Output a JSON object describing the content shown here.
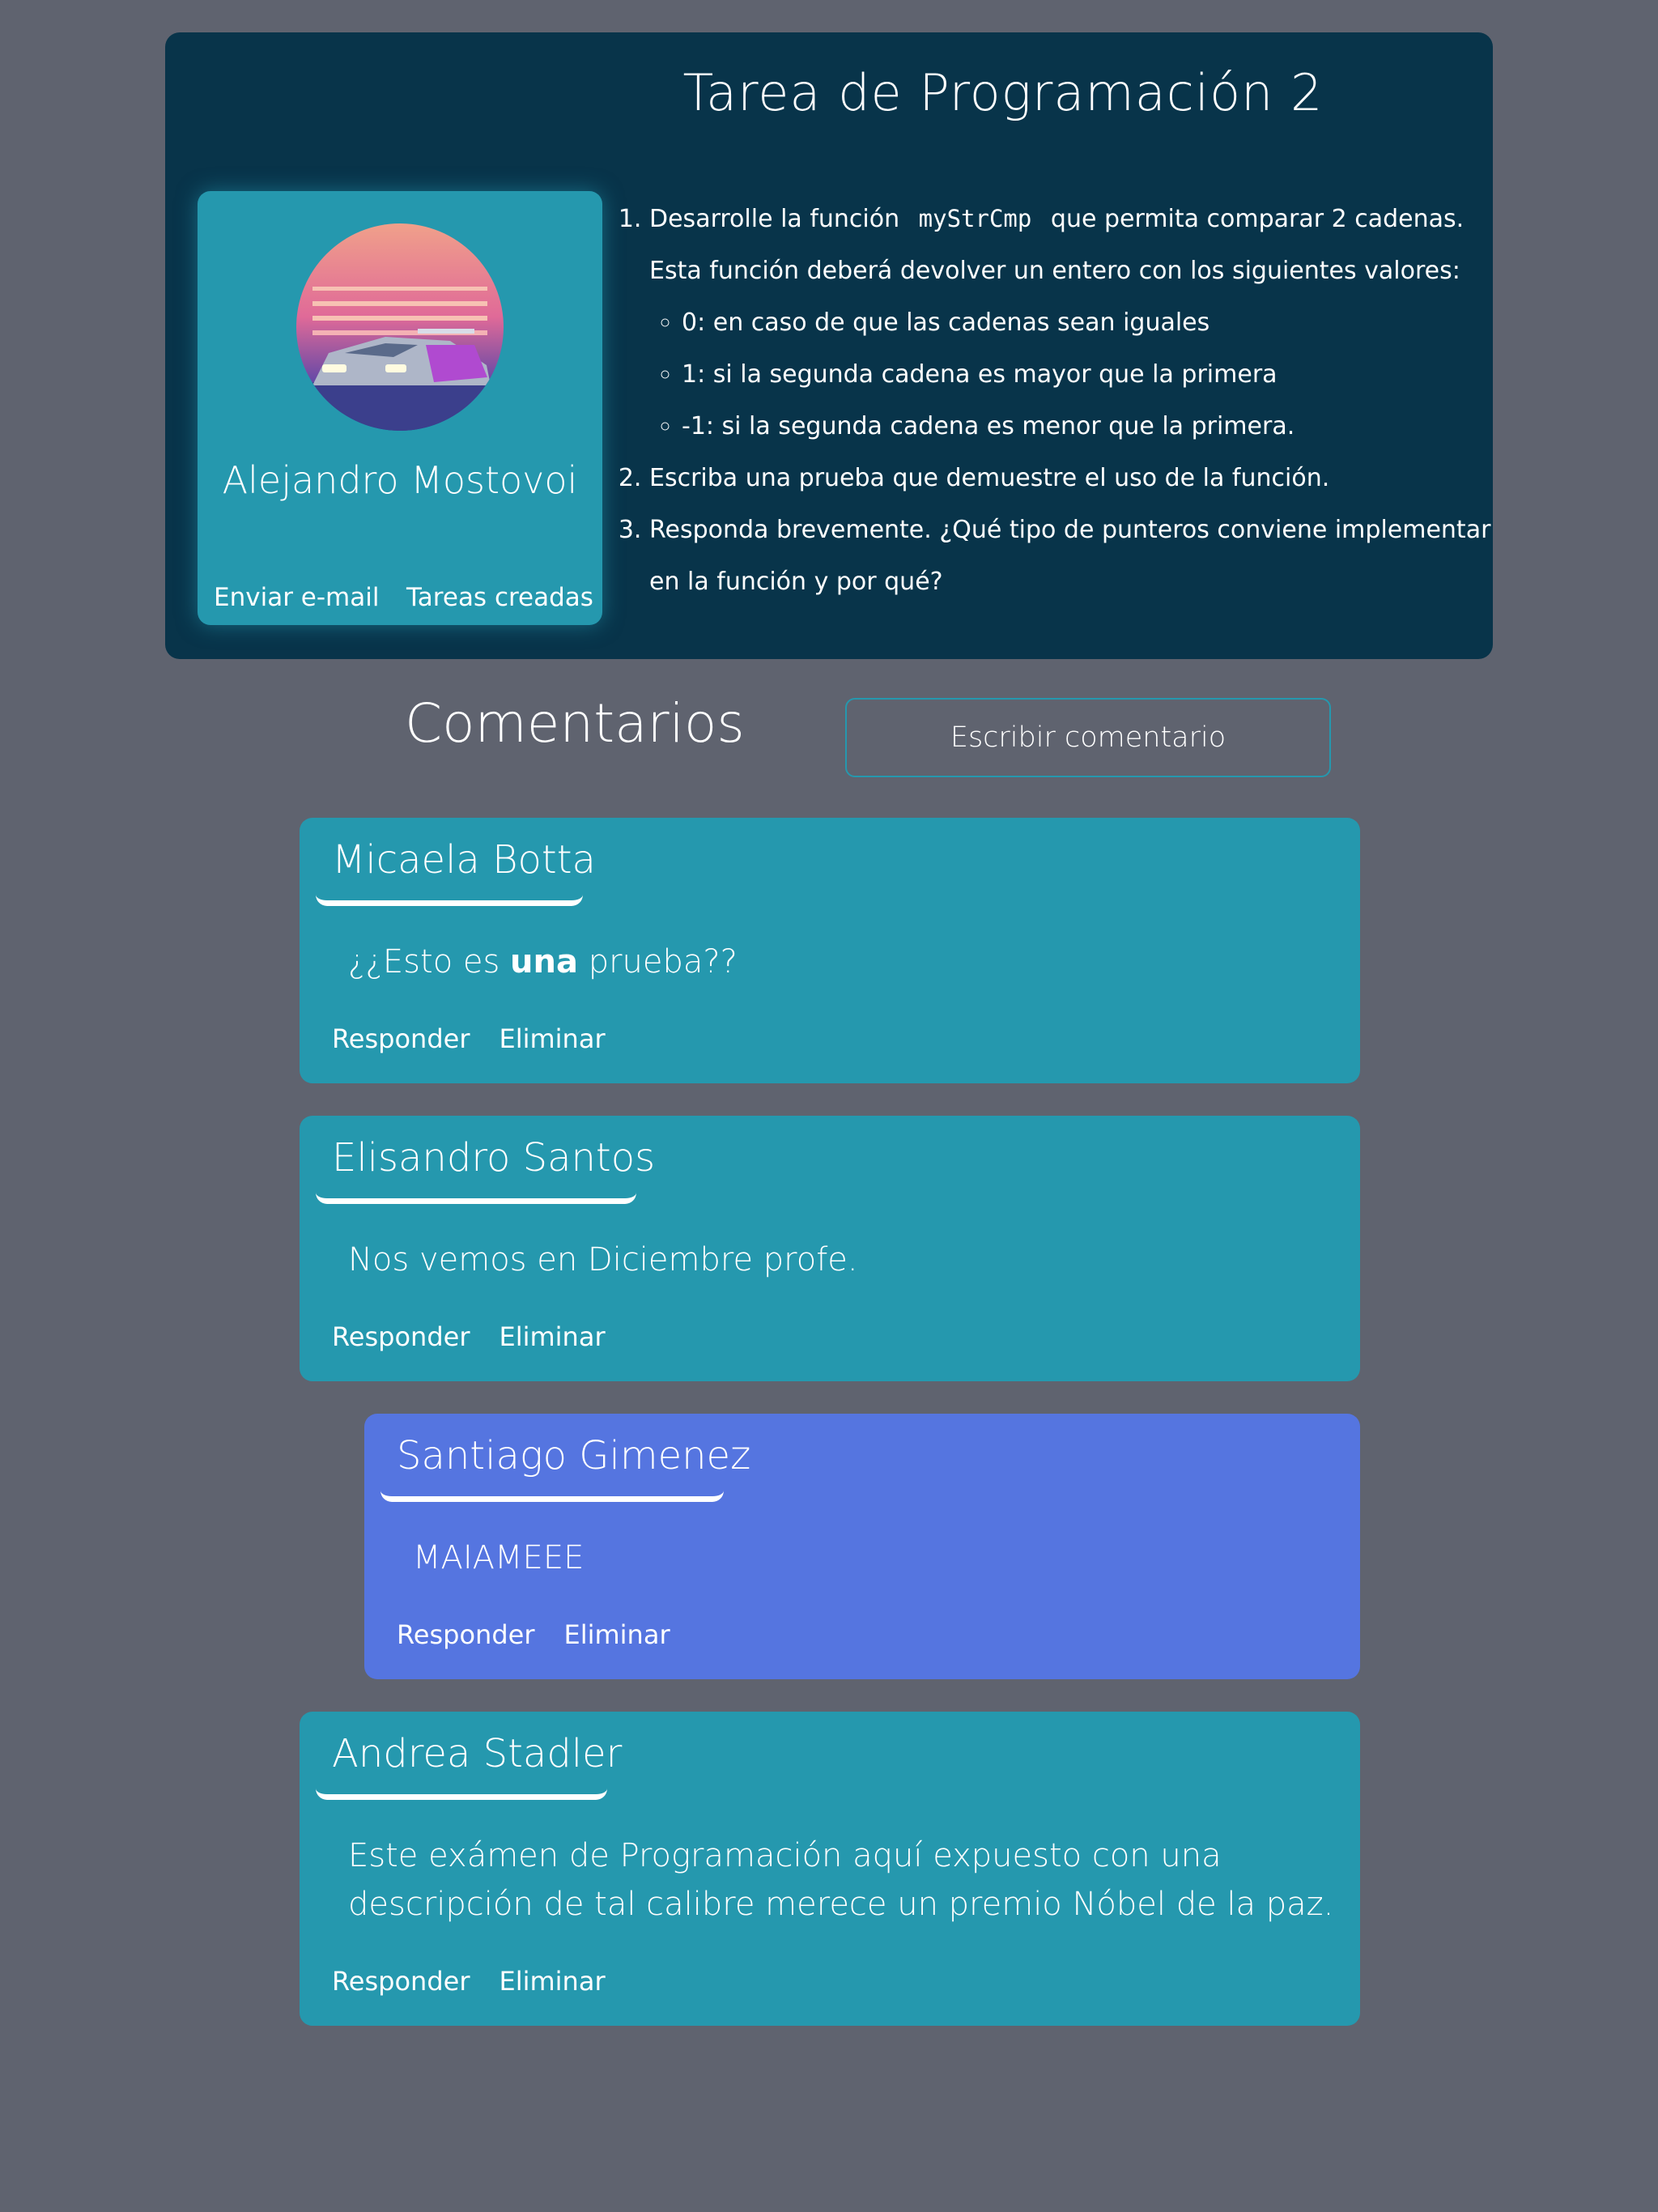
{
  "task": {
    "title": "Tarea de Programación 2",
    "author": {
      "name": "Alejandro Mostovoi",
      "email_link": "Enviar e-mail",
      "tasks_link": "Tareas creadas"
    },
    "items": [
      {
        "pre": "Desarrolle la función",
        "code": "myStrCmp",
        "post": "que permita comparar 2 cadenas. Esta función deberá devolver un entero con los siguientes valores:",
        "subitems": [
          "0: en caso de que las cadenas sean iguales",
          "1: si la segunda cadena es mayor que la primera",
          "-1: si la segunda cadena es menor que la primera."
        ]
      },
      {
        "text": "Escriba una prueba que demuestre el uso de la función."
      },
      {
        "text": "Responda brevemente. ¿Qué tipo de punteros conviene implementar en la función y por qué?"
      }
    ]
  },
  "comments_section": {
    "heading": "Comentarios",
    "write_button": "Escribir comentario"
  },
  "comments": [
    {
      "author": "Micaela Botta",
      "text_before": "¿¿Esto es ",
      "text_bold": "una",
      "text_after": " prueba??",
      "reply": "Responder",
      "delete": "Eliminar"
    },
    {
      "author": "Elisandro Santos",
      "text": "Nos vemos en Diciembre profe.",
      "reply": "Responder",
      "delete": "Eliminar"
    },
    {
      "author": "Santiago Gimenez",
      "text": "MAIAMEEE",
      "reply": "Responder",
      "delete": "Eliminar"
    },
    {
      "author": "Andrea Stadler",
      "text": "Este exámen de Programación aquí expuesto con una descripción de tal calibre merece un premio Nóbel de la paz.",
      "reply": "Responder",
      "delete": "Eliminar"
    }
  ],
  "colors": {
    "background": "#5f636f",
    "task_card": "#08344a",
    "comment_card": "#2598ae",
    "reply_card": "#5575e0"
  }
}
